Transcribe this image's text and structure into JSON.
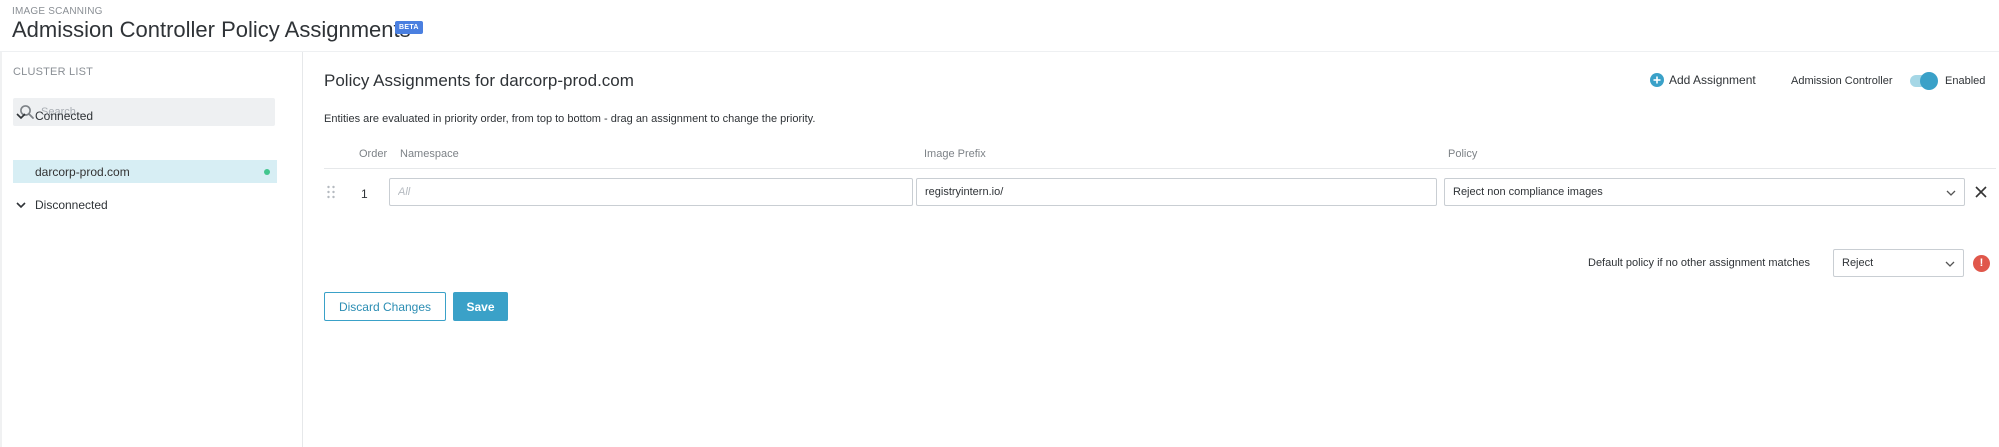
{
  "header": {
    "eyebrow": "IMAGE SCANNING",
    "title": "Admission Controller Policy Assignments",
    "badge": "BETA"
  },
  "sidebar": {
    "heading": "CLUSTER LIST",
    "search_placeholder": "Search...",
    "groups": [
      {
        "label": "Connected",
        "expanded": true,
        "clusters": [
          {
            "name": "darcorp-prod.com",
            "status": "connected",
            "selected": true
          }
        ]
      },
      {
        "label": "Disconnected",
        "expanded": true,
        "clusters": []
      }
    ],
    "colors": {
      "selected_bg": "#d7eef4",
      "connected_dot": "#42c68e"
    }
  },
  "main": {
    "title": "Policy Assignments for darcorp-prod.com",
    "add_assignment_label": "Add Assignment",
    "admission_controller_label": "Admission Controller",
    "admission_controller_status": "Enabled",
    "admission_controller_enabled": true,
    "description": "Entities are evaluated in priority order, from top to bottom - drag an assignment to change the priority.",
    "columns": {
      "order": "Order",
      "namespace": "Namespace",
      "image_prefix": "Image Prefix",
      "policy": "Policy"
    },
    "rows": [
      {
        "order": "1",
        "namespace_value": "",
        "namespace_placeholder": "All",
        "image_prefix_value": "registryintern.io/",
        "policy": "Reject non compliance images"
      }
    ],
    "default_policy_label": "Default policy if no other assignment matches",
    "default_policy_value": "Reject",
    "warning_glyph": "!",
    "discard_label": "Discard Changes",
    "save_label": "Save",
    "colors": {
      "accent": "#3aa1c8",
      "warning": "#e0574b",
      "badge": "#4a7fe0"
    }
  }
}
